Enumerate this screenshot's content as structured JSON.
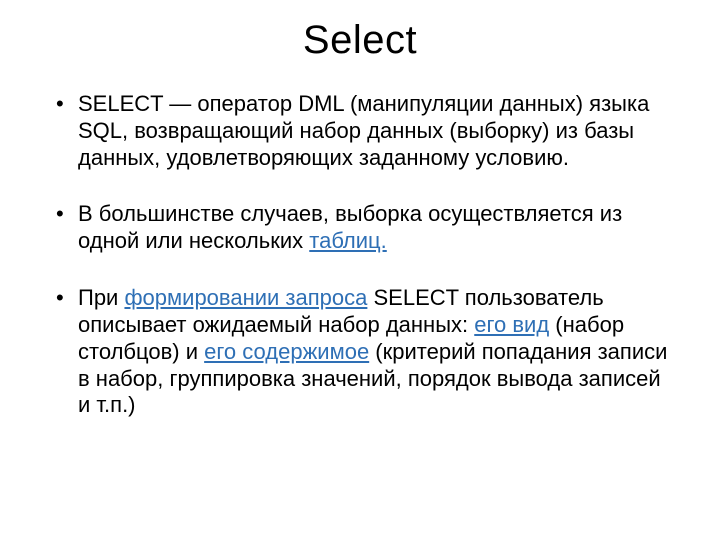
{
  "title": "Select",
  "bullets": [
    {
      "segments": [
        {
          "text": "SELECT — оператор DML (манипуляции данных) языка SQL, возвращающий набор данных (выборку) из базы данных, удовлетворяющих заданному условию.",
          "link": false
        }
      ]
    },
    {
      "segments": [
        {
          "text": "В большинстве случаев, выборка осуществляется из одной или нескольких ",
          "link": false
        },
        {
          "text": "таблиц.",
          "link": true
        }
      ]
    },
    {
      "segments": [
        {
          "text": "При ",
          "link": false
        },
        {
          "text": "формировании запроса",
          "link": true
        },
        {
          "text": " SELECT пользователь описывает ожидаемый набор данных: ",
          "link": false
        },
        {
          "text": "его вид",
          "link": true
        },
        {
          "text": " (набор столбцов) и ",
          "link": false
        },
        {
          "text": "его содержимое",
          "link": true
        },
        {
          "text": " (критерий попадания записи в набор, группировка значений, порядок вывода записей и т.п.)",
          "link": false
        }
      ]
    }
  ],
  "colors": {
    "link": "#2e6fb5",
    "text": "#000000",
    "background": "#ffffff"
  }
}
